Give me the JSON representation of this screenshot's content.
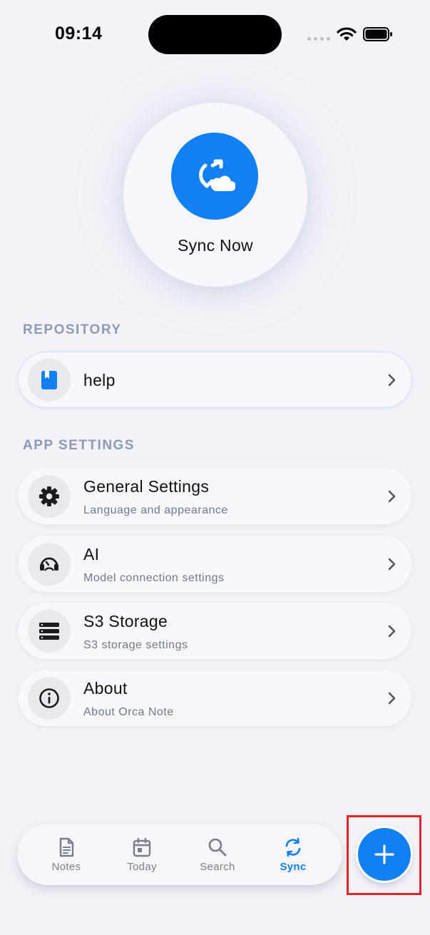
{
  "status_bar": {
    "time": "09:14"
  },
  "sync": {
    "label": "Sync Now",
    "icon": "cloud-sync-icon"
  },
  "repository": {
    "header": "REPOSITORY",
    "item": {
      "title": "help",
      "icon": "book-icon"
    }
  },
  "app_settings": {
    "header": "APP SETTINGS",
    "items": [
      {
        "title": "General Settings",
        "subtitle": "Language and appearance",
        "icon": "gear-icon"
      },
      {
        "title": "AI",
        "subtitle": "Model connection settings",
        "icon": "ai-assistant-icon"
      },
      {
        "title": "S3 Storage",
        "subtitle": "S3 storage settings",
        "icon": "storage-icon"
      },
      {
        "title": "About",
        "subtitle": "About Orca Note",
        "icon": "info-icon"
      }
    ]
  },
  "tabbar": {
    "tabs": [
      {
        "label": "Notes",
        "icon": "document-icon",
        "active": false
      },
      {
        "label": "Today",
        "icon": "calendar-icon",
        "active": false
      },
      {
        "label": "Search",
        "icon": "search-icon",
        "active": false
      },
      {
        "label": "Sync",
        "icon": "sync-icon",
        "active": true
      }
    ]
  },
  "fab": {
    "icon": "plus-icon"
  },
  "colors": {
    "accent": "#1180f5",
    "highlight_frame": "#e3252a",
    "section_header": "#8c9bb3"
  }
}
